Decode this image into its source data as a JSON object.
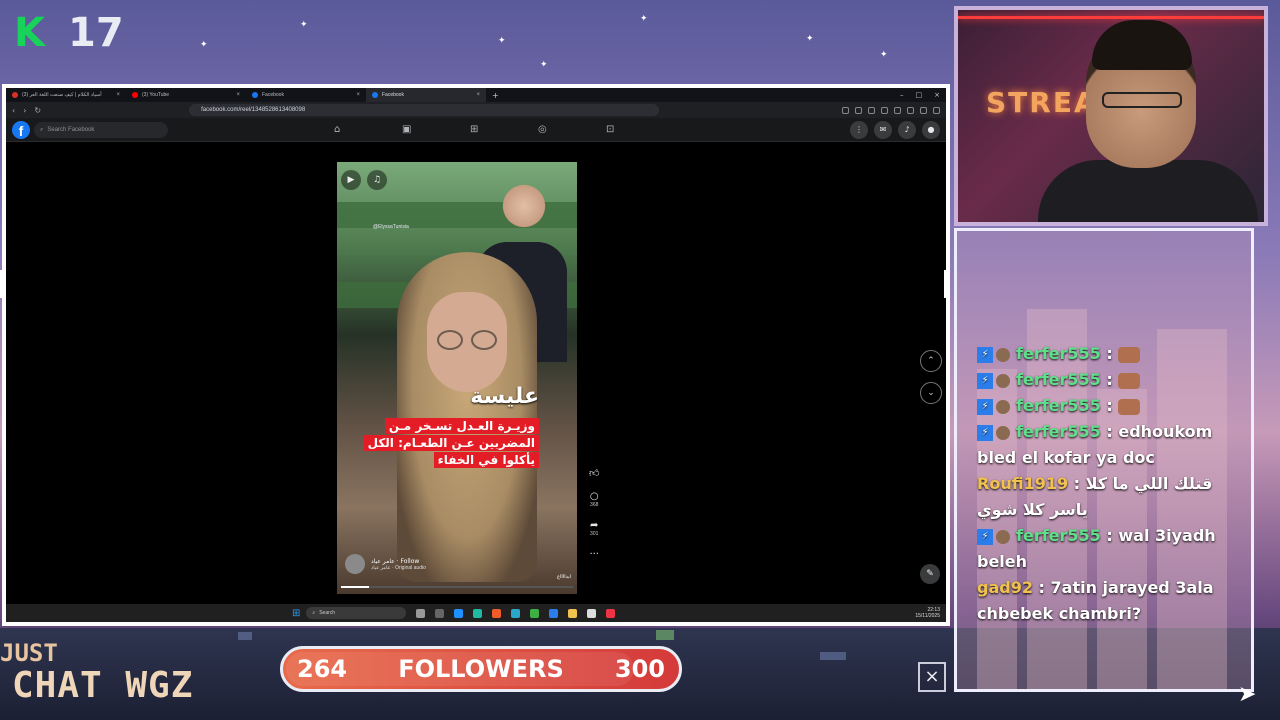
{
  "overlay": {
    "k_count": "17",
    "followers": {
      "current": "264",
      "label": "FOLLOWERS",
      "goal": "300",
      "progress_fraction": 0.88
    },
    "brand_line1": "JUST",
    "brand_line2": "CHAT WGZ",
    "webcam_sign": "STREA"
  },
  "browser": {
    "tabs": [
      {
        "title": "(3) أسياد الكلام | كيف صنعت اللغة العر",
        "color": "#d93025"
      },
      {
        "title": "(3) YouTube",
        "color": "#ff0000"
      },
      {
        "title": "Facebook",
        "color": "#1877f2"
      },
      {
        "title": "Facebook",
        "color": "#1877f2",
        "active": true
      }
    ],
    "url": "facebook.com/reel/1348528613408098",
    "new_tab": "+"
  },
  "facebook": {
    "logo": "f",
    "search_placeholder": "Search Facebook"
  },
  "reel": {
    "watermark": "@ElyssaTunisia",
    "brand": "عليسة",
    "caption_lines": [
      "وزيـرة العـدل تسـخر مـن",
      "المضربين عـن الطعـام: الكل",
      "يأكلوا في الخفاء"
    ],
    "author": "عامر عياد",
    "follow": "Follow",
    "audio": "عامر عياد · Original audio",
    "tag": "ابدااااع",
    "playback_fraction": 0.12,
    "comments": "368",
    "shares": "301"
  },
  "taskbar": {
    "search": "Search",
    "time": "22:13",
    "date": "15/11/2025"
  },
  "chat": [
    {
      "user": "ferfer555",
      "badge": true,
      "emote": true,
      "text": "",
      "color": "#5ee08a"
    },
    {
      "user": "ferfer555",
      "badge": true,
      "emote": true,
      "text": "",
      "color": "#5ee08a"
    },
    {
      "user": "ferfer555",
      "badge": true,
      "emote": true,
      "text": "",
      "color": "#5ee08a"
    },
    {
      "user": "ferfer555",
      "badge": true,
      "emote": false,
      "text": "edhoukom bled el kofar ya doc",
      "color": "#5ee08a"
    },
    {
      "user": "Roufi1919",
      "badge": false,
      "emote": false,
      "text": "قتلك اللي ما كلا ياسر كلا شوي",
      "color": "#f1c24e"
    },
    {
      "user": "ferfer555",
      "badge": true,
      "emote": false,
      "text": "wal 3iyadh beleh",
      "color": "#5ee08a"
    },
    {
      "user": "gad92",
      "badge": false,
      "emote": false,
      "text": "7atin jarayed 3ala chbebek chambri?",
      "color": "#f1c24e"
    }
  ],
  "colors": {
    "fb_blue": "#1877f2",
    "kick_green": "#17d35a",
    "follow_bar": "#d43a3a"
  }
}
